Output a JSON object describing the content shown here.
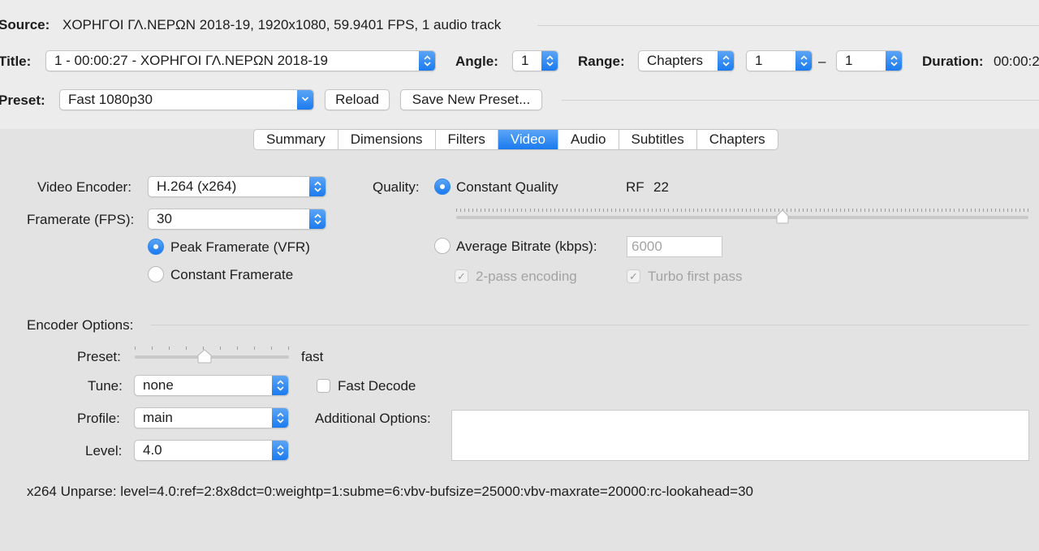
{
  "source": {
    "label": "Source:",
    "value": "ΧΟΡΗΓΟΙ ΓΛ.ΝΕΡΩΝ 2018-19, 1920x1080, 59.9401 FPS, 1 audio track"
  },
  "title_row": {
    "title_label": "Title:",
    "title_value": "1 - 00:00:27 - ΧΟΡΗΓΟΙ ΓΛ.ΝΕΡΩΝ 2018-19",
    "angle_label": "Angle:",
    "angle_value": "1",
    "range_label": "Range:",
    "range_type": "Chapters",
    "range_start": "1",
    "range_sep": "–",
    "range_end": "1",
    "duration_label": "Duration:",
    "duration_value": "00:00:2"
  },
  "preset_row": {
    "label": "Preset:",
    "value": "Fast 1080p30",
    "reload": "Reload",
    "save_new": "Save New Preset..."
  },
  "tabs": [
    {
      "label": "Summary"
    },
    {
      "label": "Dimensions"
    },
    {
      "label": "Filters"
    },
    {
      "label": "Video",
      "active": true
    },
    {
      "label": "Audio"
    },
    {
      "label": "Subtitles"
    },
    {
      "label": "Chapters"
    }
  ],
  "video": {
    "encoder_label": "Video Encoder:",
    "encoder_value": "H.264 (x264)",
    "framerate_label": "Framerate (FPS):",
    "framerate_value": "30",
    "peak_label": "Peak Framerate (VFR)",
    "constant_label": "Constant Framerate",
    "quality_label": "Quality:",
    "cq_label": "Constant Quality",
    "rf_label": "RF",
    "rf_value": "22",
    "rf_slider_fraction": 0.57,
    "abr_label": "Average Bitrate (kbps):",
    "abr_value": "6000",
    "two_pass_label": "2-pass encoding",
    "turbo_label": "Turbo first pass"
  },
  "encoder_options": {
    "section_label": "Encoder Options:",
    "preset_label": "Preset:",
    "preset_value": "fast",
    "preset_slider_fraction": 0.45,
    "tune_label": "Tune:",
    "tune_value": "none",
    "fast_decode_label": "Fast Decode",
    "profile_label": "Profile:",
    "profile_value": "main",
    "additional_label": "Additional Options:",
    "additional_value": "",
    "level_label": "Level:",
    "level_value": "4.0"
  },
  "unparse": "x264 Unparse: level=4.0:ref=2:8x8dct=0:weightp=1:subme=6:vbv-bufsize=25000:vbv-maxrate=20000:rc-lookahead=30",
  "colors": {
    "accent": "#1b7bef",
    "window_bg": "#ececec",
    "panel_bg": "#e3e3e3"
  }
}
